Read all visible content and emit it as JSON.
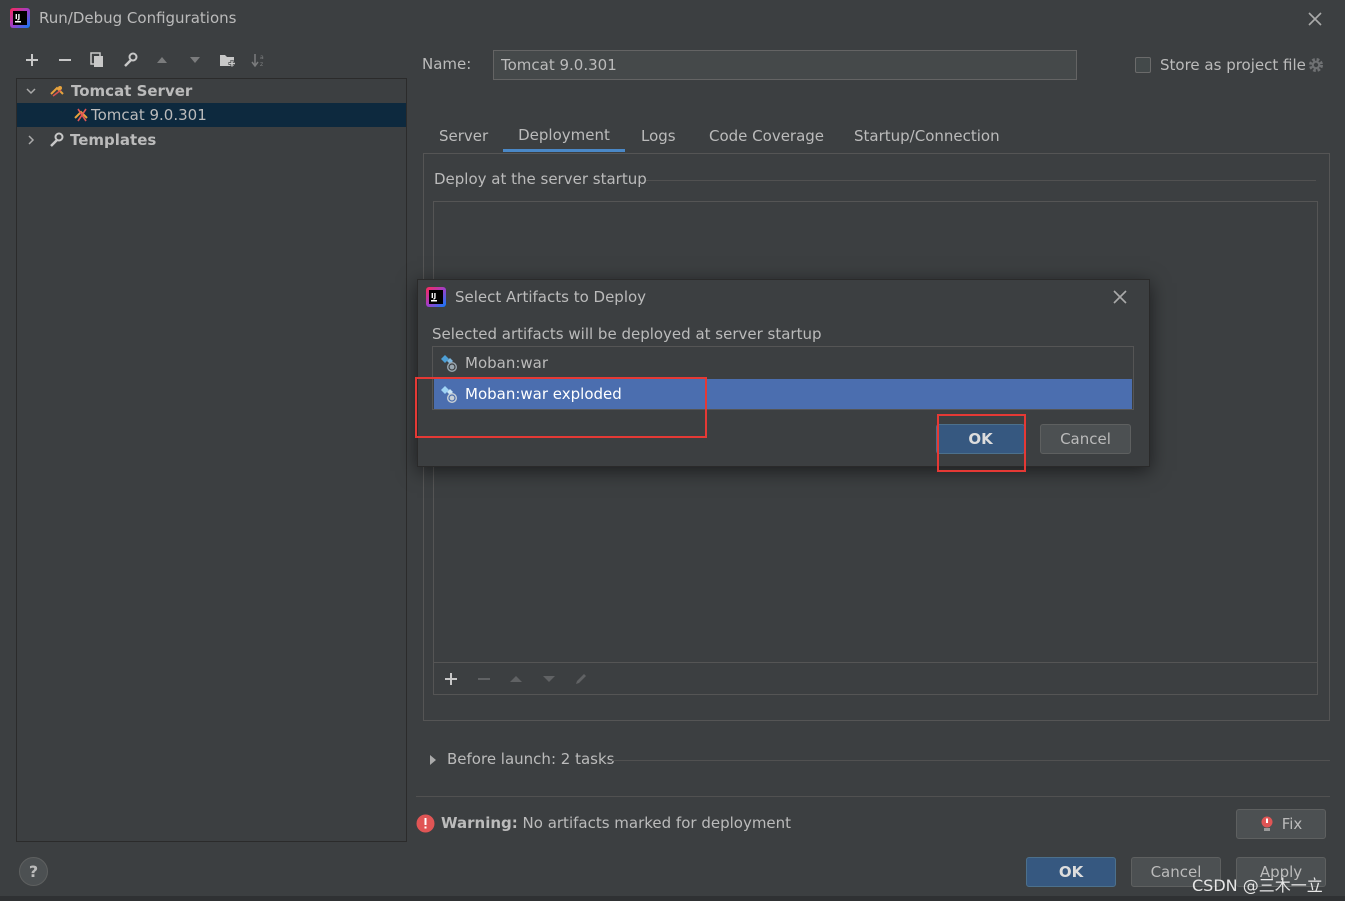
{
  "window": {
    "title": "Run/Debug Configurations"
  },
  "toolbar": {
    "icons": [
      "add-icon",
      "remove-icon",
      "copy-icon",
      "wrench-icon",
      "move-up-icon",
      "move-down-icon",
      "folder-add-icon",
      "sort-icon"
    ]
  },
  "tree": {
    "group_label": "Tomcat Server",
    "config_label": "Tomcat 9.0.301",
    "templates_label": "Templates"
  },
  "form": {
    "name_label": "Name:",
    "name_value": "Tomcat 9.0.301",
    "store_label": "Store as project file",
    "store_checked": false
  },
  "tabs": [
    {
      "label": "Server"
    },
    {
      "label": "Deployment",
      "active": true
    },
    {
      "label": "Logs"
    },
    {
      "label": "Code Coverage"
    },
    {
      "label": "Startup/Connection"
    }
  ],
  "deployment": {
    "legend": "Deploy at the server startup"
  },
  "before_launch": {
    "label": "Before launch: 2 tasks"
  },
  "warning": {
    "bold": "Warning:",
    "text": " No artifacts marked for deployment",
    "color": "#e05555"
  },
  "buttons": {
    "fix": "Fix",
    "ok": "OK",
    "cancel": "Cancel",
    "apply": "Apply",
    "help": "?"
  },
  "dialog": {
    "title": "Select Artifacts to Deploy",
    "description": "Selected artifacts will be deployed at server startup",
    "artifacts": [
      {
        "label": "Moban:war",
        "selected": false
      },
      {
        "label": "Moban:war exploded",
        "selected": true
      }
    ],
    "ok": "OK",
    "cancel": "Cancel"
  },
  "watermark": "CSDN @三木一立",
  "colors": {
    "background": "#3c3f41",
    "selection": "#4b6eaf",
    "tree_selection": "#0d293e",
    "accent": "#4a88c7",
    "annotation": "#e53935"
  }
}
